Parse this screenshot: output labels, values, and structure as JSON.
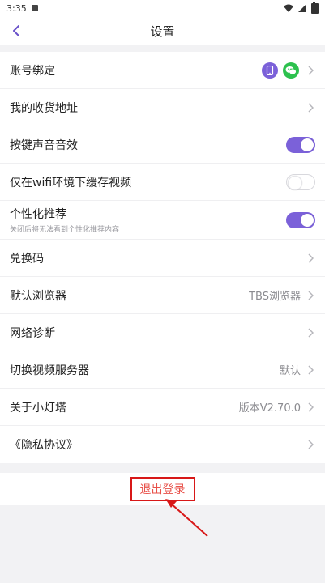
{
  "statusbar": {
    "time": "3:35"
  },
  "header": {
    "title": "设置",
    "back_icon": "back-chevron-icon"
  },
  "settings": [
    {
      "label": "账号绑定",
      "type": "accounts"
    },
    {
      "label": "我的收货地址",
      "type": "link"
    },
    {
      "label": "按键声音音效",
      "type": "toggle",
      "on": true
    },
    {
      "label": "仅在wifi环境下缓存视频",
      "type": "toggle",
      "on": false
    },
    {
      "label": "个性化推荐",
      "sub": "关闭后将无法看到个性化推荐内容",
      "type": "toggle",
      "on": true
    },
    {
      "label": "兑换码",
      "type": "link"
    },
    {
      "label": "默认浏览器",
      "value": "TBS浏览器",
      "type": "link"
    },
    {
      "label": "网络诊断",
      "type": "link"
    },
    {
      "label": "切换视频服务器",
      "value": "默认",
      "type": "link"
    },
    {
      "label": "关于小灯塔",
      "value": "版本V2.70.0",
      "type": "link"
    },
    {
      "label": "《隐私协议》",
      "type": "link"
    }
  ],
  "logout": {
    "label": "退出登录"
  },
  "colors": {
    "accent": "#7b61d9",
    "wechat": "#2dc14e",
    "highlight": "#d81818",
    "logout_text": "#e8514a"
  }
}
